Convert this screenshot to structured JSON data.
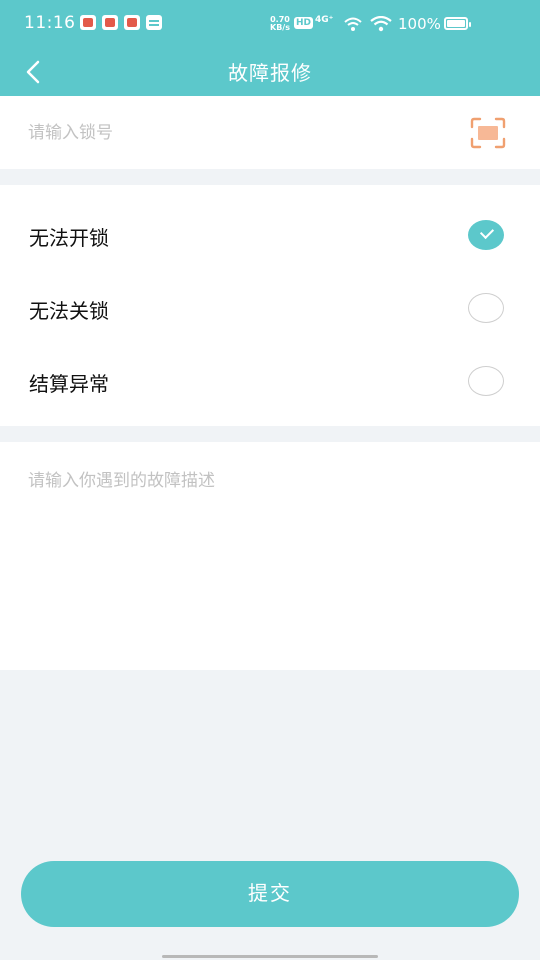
{
  "status_bar": {
    "time": "11:16",
    "net_speed_value": "0.70",
    "net_speed_unit": "KB/s",
    "hd_label": "HD",
    "signal_label": "4G⁺",
    "battery_percent": "100%"
  },
  "header": {
    "title": "故障报修",
    "back_icon": "chevron-left-icon"
  },
  "lock_input": {
    "placeholder": "请输入锁号",
    "value": "",
    "scan_icon": "scan-icon",
    "scan_icon_color": "#f0a070"
  },
  "fault_options": [
    {
      "label": "无法开锁",
      "checked": true
    },
    {
      "label": "无法关锁",
      "checked": false
    },
    {
      "label": "结算异常",
      "checked": false
    }
  ],
  "description": {
    "placeholder": "请输入你遇到的故障描述",
    "value": ""
  },
  "submit": {
    "label": "提交"
  },
  "colors": {
    "accent": "#5cc8cb",
    "background": "#f0f3f6",
    "placeholder": "#c2c2c2"
  }
}
